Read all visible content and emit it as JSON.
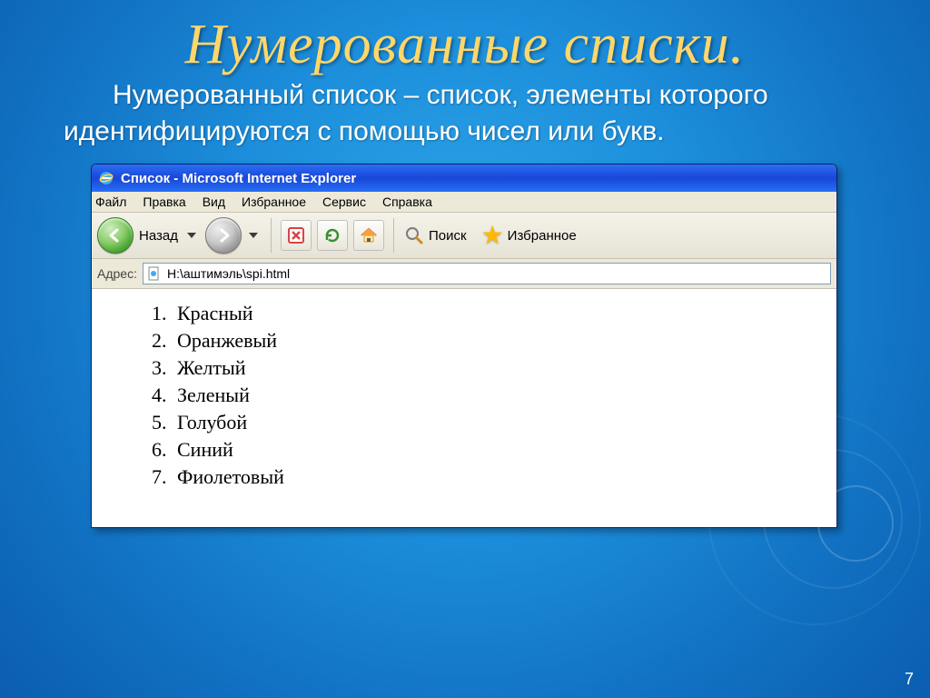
{
  "slide": {
    "title": "Нумерованные списки.",
    "body": "Нумерованный список – список, элементы которого идентифицируются с помощью чисел или букв.",
    "page_number": "7"
  },
  "ie": {
    "title": "Список - Microsoft Internet Explorer",
    "menu": [
      "Файл",
      "Правка",
      "Вид",
      "Избранное",
      "Сервис",
      "Справка"
    ],
    "toolbar": {
      "back_label": "Назад",
      "search_label": "Поиск",
      "favorites_label": "Избранное"
    },
    "address_label": "Адрес:",
    "address_value": "H:\\аштимэль\\spi.html",
    "list_items": [
      "Красный",
      "Оранжевый",
      "Желтый",
      "Зеленый",
      "Голубой",
      "Синий",
      "Фиолетовый"
    ]
  }
}
